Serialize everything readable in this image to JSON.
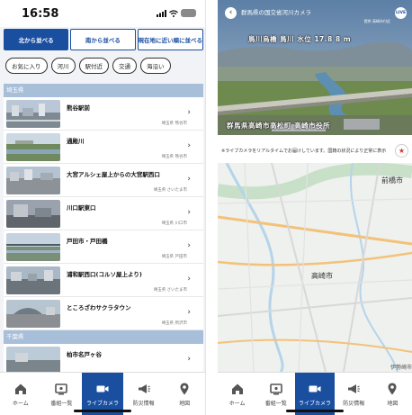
{
  "left": {
    "time": "16:58",
    "sort_tabs": [
      {
        "label": "北から並べる"
      },
      {
        "label": "南から並べる"
      },
      {
        "label": "現在地に近い順に並べる"
      }
    ],
    "chips": [
      {
        "label": "お気に入り"
      },
      {
        "label": "河川"
      },
      {
        "label": "駅付近"
      },
      {
        "label": "交通"
      },
      {
        "label": "海沿い"
      }
    ],
    "sections": [
      {
        "name": "埼玉県"
      },
      {
        "name": "千葉県"
      }
    ],
    "cameras": [
      {
        "name": "熊谷駅前",
        "location": "埼玉県 熊谷市"
      },
      {
        "name": "通殿川",
        "location": "埼玉県 熊谷市"
      },
      {
        "name": "大宮アルシェ屋上からの大宮駅西口",
        "location": "埼玉県 さいたま市"
      },
      {
        "name": "川口駅東口",
        "location": "埼玉県 川口市"
      },
      {
        "name": "戸田市・戸田橋",
        "location": "埼玉県 戸田市"
      },
      {
        "name": "浦和駅西口(コルソ屋上より)",
        "location": "埼玉県 さいたま市"
      },
      {
        "name": "ところざわサクラタウン",
        "location": "埼玉県 所沢市"
      },
      {
        "name": "柏市名戸ヶ谷",
        "location": ""
      }
    ],
    "tabs": [
      {
        "label": "ホーム",
        "icon": "house-icon"
      },
      {
        "label": "番組一覧",
        "icon": "tv-icon"
      },
      {
        "label": "ライブカメラ",
        "icon": "video-camera-icon"
      },
      {
        "label": "防災情報",
        "icon": "megaphone-icon"
      },
      {
        "label": "地図",
        "icon": "map-pin-icon"
      }
    ]
  },
  "right": {
    "title": "群馬県の国交省河川カメラ",
    "subtitle": "提供 高崎市付近",
    "live_badge": "LIVE",
    "overlay_top": "鳥川烏橋  鳥川  水位  17.8 8 m",
    "overlay_bottom": "群馬県高崎市高松町  高崎市役所",
    "notice": "※ライブカメラをリアルタイムでお届けしています。国籍の状況により正常に表示",
    "map_labels": [
      {
        "text": "前橋市"
      },
      {
        "text": "高崎市"
      },
      {
        "text": "伊勢崎市"
      }
    ],
    "tabs": [
      {
        "label": "ホーム",
        "icon": "house-icon"
      },
      {
        "label": "番組一覧",
        "icon": "tv-icon"
      },
      {
        "label": "ライブカメラ",
        "icon": "video-camera-icon"
      },
      {
        "label": "防災情報",
        "icon": "megaphone-icon"
      },
      {
        "label": "地図",
        "icon": "map-pin-icon"
      }
    ]
  },
  "colors": {
    "primary": "#1a4fa0",
    "section_header": "#a8bfd9",
    "background": "#f2f3f6"
  }
}
